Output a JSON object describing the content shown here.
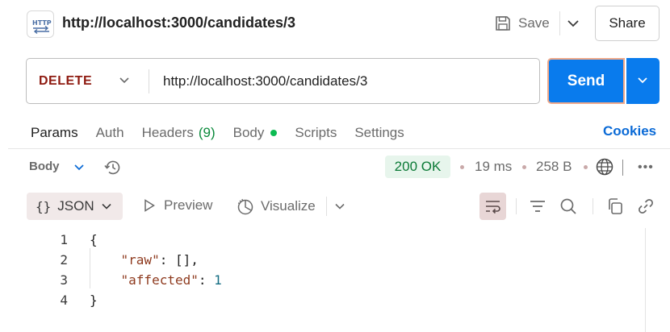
{
  "tab": {
    "icon": "http-icon",
    "title": "http://localhost:3000/candidates/3"
  },
  "header": {
    "save_label": "Save",
    "share_label": "Share"
  },
  "request": {
    "method": "DELETE",
    "method_color": "#8e1a10",
    "url": "http://localhost:3000/candidates/3",
    "send_label": "Send",
    "send_color": "#097bed"
  },
  "request_tabs": {
    "params": "Params",
    "auth": "Auth",
    "headers": "Headers",
    "headers_count": "(9)",
    "body": "Body",
    "scripts": "Scripts",
    "settings": "Settings",
    "cookies": "Cookies"
  },
  "response": {
    "body_label": "Body",
    "status": "200 OK",
    "status_color": "#0b7a36",
    "time": "19 ms",
    "size": "258 B"
  },
  "response_toolbar": {
    "format_braces": "{}",
    "format_label": "JSON",
    "preview_label": "Preview",
    "visualize_label": "Visualize"
  },
  "editor": {
    "line_numbers": [
      "1",
      "2",
      "3",
      "4"
    ],
    "line1": "{",
    "line2_key": "\"raw\"",
    "line2_rest": ": [],",
    "line3_key": "\"affected\"",
    "line3_sep": ": ",
    "line3_value": "1",
    "line4": "}"
  }
}
